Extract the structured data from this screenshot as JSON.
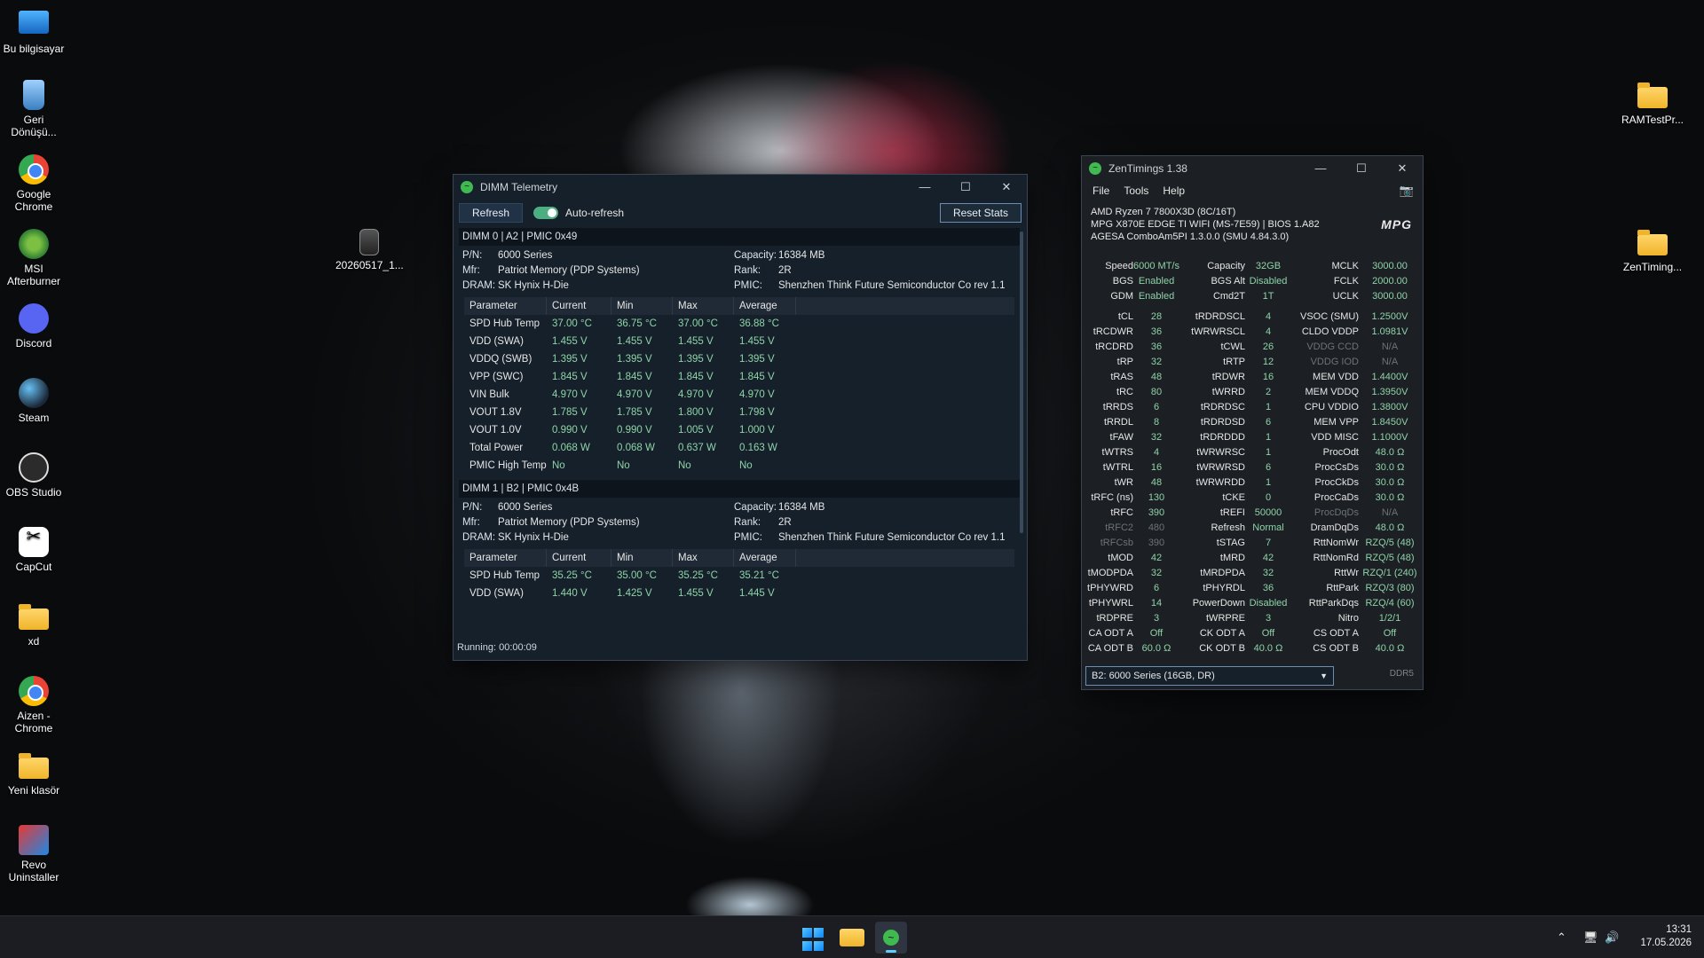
{
  "desktop": {
    "left_icons": [
      {
        "label": "Bu bilgisayar",
        "icon": "this-pc-icon"
      },
      {
        "label": "Geri Dönüşü...",
        "icon": "recycle-bin-icon"
      },
      {
        "label": "Google Chrome",
        "icon": "chrome-icon"
      },
      {
        "label": "MSI Afterburner",
        "icon": "msi-afterburner-icon"
      },
      {
        "label": "Discord",
        "icon": "discord-icon"
      },
      {
        "label": "Steam",
        "icon": "steam-icon"
      },
      {
        "label": "OBS Studio",
        "icon": "obs-icon"
      },
      {
        "label": "CapCut",
        "icon": "capcut-icon"
      },
      {
        "label": "xd",
        "icon": "folder-icon"
      },
      {
        "label": "Aizen - Chrome",
        "icon": "chrome-icon"
      },
      {
        "label": "Yeni klasör",
        "icon": "folder-icon"
      },
      {
        "label": "Revo Uninstaller",
        "icon": "revo-icon"
      }
    ],
    "file_icon": {
      "label": "20260517_1..."
    },
    "right_icons": [
      {
        "label": "RAMTestPr...",
        "icon": "folder-icon"
      },
      {
        "label": "ZenTiming...",
        "icon": "folder-icon"
      }
    ]
  },
  "dimm": {
    "title": "DIMM Telemetry",
    "refresh": "Refresh",
    "auto_refresh": "Auto-refresh",
    "reset": "Reset Stats",
    "status": "Running: 00:00:09",
    "columns": [
      "Parameter",
      "Current",
      "Min",
      "Max",
      "Average"
    ],
    "dimms": [
      {
        "header": "DIMM 0 | A2 | PMIC 0x49",
        "pn_k": "P/N:",
        "pn": "6000 Series",
        "mfr_k": "Mfr:",
        "mfr": "Patriot Memory (PDP Systems)",
        "dram_k": "DRAM:",
        "dram": "SK Hynix H-Die",
        "cap_k": "Capacity:",
        "cap": "16384 MB",
        "rank_k": "Rank:",
        "rank": "2R",
        "pmic_k": "PMIC:",
        "pmic": "Shenzhen Think Future Semiconductor Co rev 1.1",
        "rows": [
          [
            "SPD Hub Temp",
            "37.00 °C",
            "36.75 °C",
            "37.00 °C",
            "36.88 °C"
          ],
          [
            "VDD (SWA)",
            "1.455 V",
            "1.455 V",
            "1.455 V",
            "1.455 V"
          ],
          [
            "VDDQ (SWB)",
            "1.395 V",
            "1.395 V",
            "1.395 V",
            "1.395 V"
          ],
          [
            "VPP (SWC)",
            "1.845 V",
            "1.845 V",
            "1.845 V",
            "1.845 V"
          ],
          [
            "VIN Bulk",
            "4.970 V",
            "4.970 V",
            "4.970 V",
            "4.970 V"
          ],
          [
            "VOUT 1.8V",
            "1.785 V",
            "1.785 V",
            "1.800 V",
            "1.798 V"
          ],
          [
            "VOUT 1.0V",
            "0.990 V",
            "0.990 V",
            "1.005 V",
            "1.000 V"
          ],
          [
            "Total Power",
            "0.068 W",
            "0.068 W",
            "0.637 W",
            "0.163 W"
          ],
          [
            "PMIC High Temp",
            "No",
            "No",
            "No",
            "No"
          ]
        ]
      },
      {
        "header": "DIMM 1 | B2 | PMIC 0x4B",
        "pn_k": "P/N:",
        "pn": "6000 Series",
        "mfr_k": "Mfr:",
        "mfr": "Patriot Memory (PDP Systems)",
        "dram_k": "DRAM:",
        "dram": "SK Hynix H-Die",
        "cap_k": "Capacity:",
        "cap": "16384 MB",
        "rank_k": "Rank:",
        "rank": "2R",
        "pmic_k": "PMIC:",
        "pmic": "Shenzhen Think Future Semiconductor Co rev 1.1",
        "rows": [
          [
            "SPD Hub Temp",
            "35.25 °C",
            "35.00 °C",
            "35.25 °C",
            "35.21 °C"
          ],
          [
            "VDD (SWA)",
            "1.440 V",
            "1.425 V",
            "1.455 V",
            "1.445 V"
          ]
        ]
      }
    ]
  },
  "zen": {
    "title": "ZenTimings 1.38",
    "menu": [
      "File",
      "Tools",
      "Help"
    ],
    "cpu": "AMD Ryzen 7 7800X3D (8C/16T)",
    "board": "MPG X870E EDGE TI WIFI (MS-7E59) | BIOS 1.A82",
    "agesa": "AGESA ComboAm5PI 1.3.0.0 (SMU 4.84.3.0)",
    "logo": "MPG",
    "top_rows": [
      [
        "Speed",
        "6000 MT/s",
        "Capacity",
        "32GB",
        "MCLK",
        "3000.00"
      ],
      [
        "BGS",
        "Enabled",
        "BGS Alt",
        "Disabled",
        "FCLK",
        "2000.00"
      ],
      [
        "GDM",
        "Enabled",
        "Cmd2T",
        "1T",
        "UCLK",
        "3000.00"
      ]
    ],
    "rows": [
      [
        "tCL",
        "28",
        "tRDRDSCL",
        "4",
        "VSOC (SMU)",
        "1.2500V"
      ],
      [
        "tRCDWR",
        "36",
        "tWRWRSCL",
        "4",
        "CLDO VDDP",
        "1.0981V"
      ],
      [
        "tRCDRD",
        "36",
        "tCWL",
        "26",
        "VDDG CCD",
        "N/A"
      ],
      [
        "tRP",
        "32",
        "tRTP",
        "12",
        "VDDG IOD",
        "N/A"
      ],
      [
        "tRAS",
        "48",
        "tRDWR",
        "16",
        "MEM VDD",
        "1.4400V"
      ],
      [
        "tRC",
        "80",
        "tWRRD",
        "2",
        "MEM VDDQ",
        "1.3950V"
      ],
      [
        "tRRDS",
        "6",
        "tRDRDSC",
        "1",
        "CPU VDDIO",
        "1.3800V"
      ],
      [
        "tRRDL",
        "8",
        "tRDRDSD",
        "6",
        "MEM VPP",
        "1.8450V"
      ],
      [
        "tFAW",
        "32",
        "tRDRDDD",
        "1",
        "VDD MISC",
        "1.1000V"
      ],
      [
        "tWTRS",
        "4",
        "tWRWRSC",
        "1",
        "ProcOdt",
        "48.0 Ω"
      ],
      [
        "tWTRL",
        "16",
        "tWRWRSD",
        "6",
        "ProcCsDs",
        "30.0 Ω"
      ],
      [
        "tWR",
        "48",
        "tWRWRDD",
        "1",
        "ProcCkDs",
        "30.0 Ω"
      ],
      [
        "tRFC (ns)",
        "130",
        "tCKE",
        "0",
        "ProcCaDs",
        "30.0 Ω"
      ],
      [
        "tRFC",
        "390",
        "tREFI",
        "50000",
        "ProcDqDs",
        "N/A"
      ],
      [
        "tRFC2",
        "480",
        "Refresh",
        "Normal",
        "DramDqDs",
        "48.0 Ω"
      ],
      [
        "tRFCsb",
        "390",
        "tSTAG",
        "7",
        "RttNomWr",
        "RZQ/5 (48)"
      ],
      [
        "tMOD",
        "42",
        "tMRD",
        "42",
        "RttNomRd",
        "RZQ/5 (48)"
      ],
      [
        "tMODPDA",
        "32",
        "tMRDPDA",
        "32",
        "RttWr",
        "RZQ/1 (240)"
      ],
      [
        "tPHYWRD",
        "6",
        "tPHYRDL",
        "36",
        "RttPark",
        "RZQ/3 (80)"
      ],
      [
        "tPHYWRL",
        "14",
        "PowerDown",
        "Disabled",
        "RttParkDqs",
        "RZQ/4 (60)"
      ],
      [
        "tRDPRE",
        "3",
        "tWRPRE",
        "3",
        "Nitro",
        "1/2/1"
      ],
      [
        "CA ODT A",
        "Off",
        "CK ODT A",
        "Off",
        "CS ODT A",
        "Off"
      ],
      [
        "CA ODT B",
        "60.0 Ω",
        "CK ODT B",
        "40.0 Ω",
        "CS ODT B",
        "40.0 Ω"
      ]
    ],
    "dim_cells": [
      "tRFC2",
      "tRFCsb",
      "VDDG CCD",
      "VDDG IOD",
      "ProcDqDs"
    ],
    "dropdown": "B2: 6000 Series (16GB, DR)",
    "memtype": "DDR5"
  },
  "taskbar": {
    "time": "13:31",
    "date": "17.05.2026"
  },
  "colors": {
    "accent_green": "#8fd4a8",
    "window_bg": "#1a1f26",
    "accent_blue": "#60cdff"
  }
}
